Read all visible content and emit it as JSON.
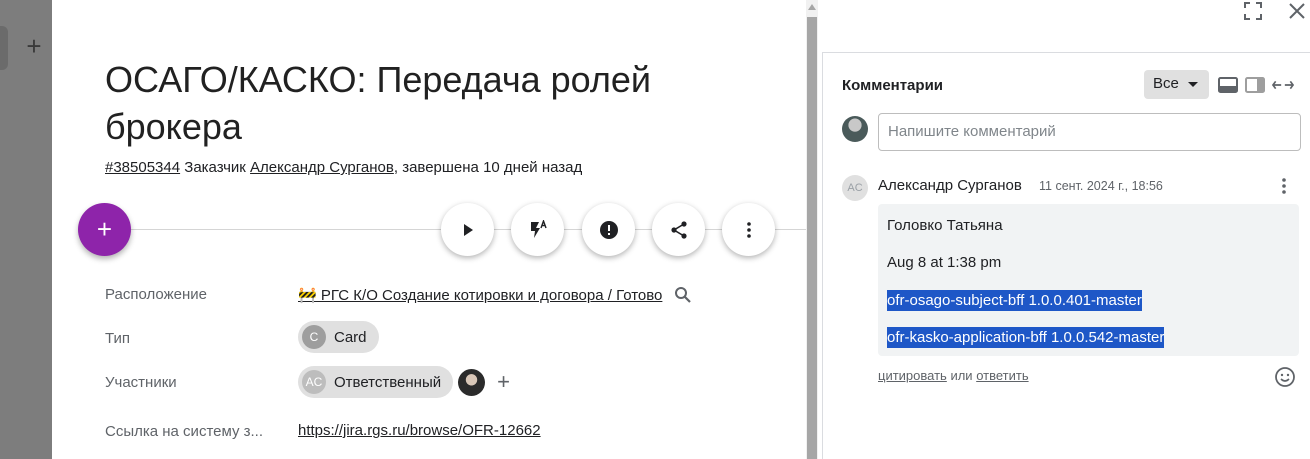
{
  "background": {
    "add_icon": "plus-icon"
  },
  "card": {
    "title": "ОСАГО/КАСКО: Передача ролей брокера",
    "meta": {
      "id": "#38505344",
      "customer_label": "Заказчик",
      "customer": "Александр Сурганов",
      "status": ", завершена 10 дней назад"
    },
    "fab_icon": "plus-icon",
    "actions": [
      "play-icon",
      "flash-auto-icon",
      "alert-icon",
      "share-icon",
      "more-vert-icon"
    ],
    "fields": {
      "location_label": "Расположение",
      "location_value": "🚧 РГС К/О Создание котировки и договора / Готово",
      "type_label": "Тип",
      "type_avatar": "C",
      "type_value": "Card",
      "members_label": "Участники",
      "member_avatar": "AC",
      "member_value": "Ответственный",
      "link_label": "Ссылка на систему з...",
      "link_value": "https://jira.rgs.ru/browse/OFR-12662"
    }
  },
  "panel": {
    "title": "Комментарии",
    "filter": "Все",
    "input_placeholder": "Напишите комментарий",
    "comment": {
      "avatar": "AC",
      "author": "Александр Сурганов",
      "date": "11 сент. 2024 г., 18:56",
      "lines": [
        "Головко Татьяна",
        "Aug 8 at 1:38 pm",
        "ofr-osago-subject-bff 1.0.0.401-master",
        "ofr-kasko-application-bff 1.0.0.542-master"
      ],
      "quote": "цитировать",
      "or": "или",
      "reply": "ответить"
    }
  },
  "colors": {
    "accent": "#8e24aa",
    "selection": "#1e57c7"
  }
}
